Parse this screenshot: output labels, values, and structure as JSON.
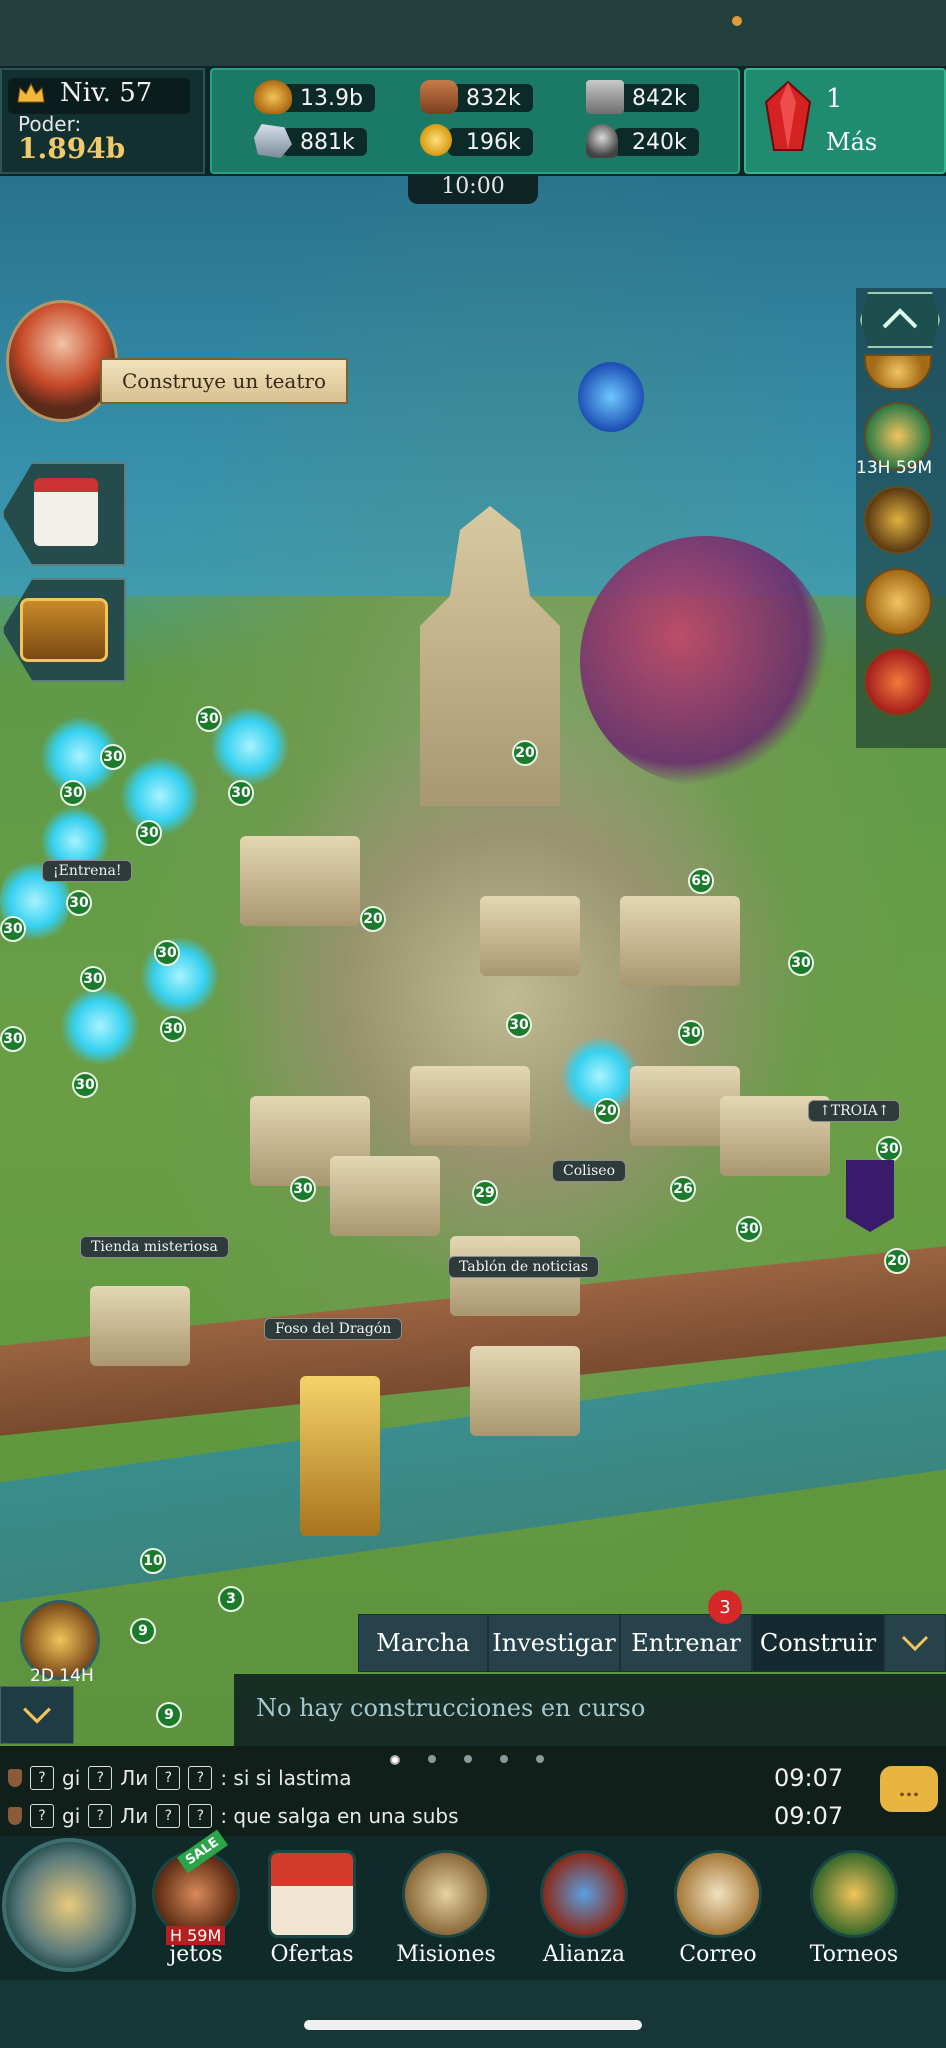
{
  "hud": {
    "level": "Niv. 57",
    "power_label": "Poder:",
    "power_value": "1.894b",
    "resources": [
      {
        "icon": "bread-icon",
        "value": "13.9b"
      },
      {
        "icon": "wood-logs-icon",
        "value": "832k"
      },
      {
        "icon": "stone-icon",
        "value": "842k"
      },
      {
        "icon": "iron-ore-icon",
        "value": "881k"
      },
      {
        "icon": "gold-coin-icon",
        "value": "196k"
      },
      {
        "icon": "helmet-icon",
        "value": "240k"
      }
    ],
    "gems": "1",
    "more_label": "Más",
    "timer": "10:00"
  },
  "map": {
    "quest_text": "Construye un teatro",
    "labels": {
      "train": "¡Entrena!",
      "troia": "↑TROIA↑",
      "coliseum": "Coliseo",
      "mystery_shop": "Tienda misteriosa",
      "notice_board": "Tablón de noticias",
      "dragon_pit": "Foso del Dragón"
    },
    "levels": [
      "30",
      "30",
      "30",
      "30",
      "30",
      "30",
      "30",
      "30",
      "30",
      "30",
      "30",
      "30",
      "20",
      "20",
      "20",
      "69",
      "30",
      "30",
      "30",
      "30",
      "29",
      "26",
      "30",
      "30",
      "20",
      "10",
      "3",
      "9",
      "9"
    ],
    "right_timer": "13H 59M",
    "gift_timer": "2D 14H"
  },
  "actions": {
    "tabs": [
      "Marcha",
      "Investigar",
      "Entrenar",
      "Construir"
    ],
    "badge": "3",
    "status": "No hay construcciones en curso"
  },
  "chat": {
    "messages": [
      {
        "user": "gi",
        "user2": "Ли",
        "text": ": si si lastima",
        "time": "09:07"
      },
      {
        "user": "gi",
        "user2": "Ли",
        "text": ": que salga en una subs",
        "time": "09:07"
      }
    ],
    "bubble": "..."
  },
  "nav": {
    "sale": "SALE",
    "sale_timer": "H 59M",
    "items": [
      "jetos",
      "Ofertas",
      "Misiones",
      "Alianza",
      "Correo",
      "Torneos"
    ]
  },
  "colors": {
    "accent_green": "#1b7a66",
    "gold_text": "#f0c96a",
    "badge_red": "#d62828",
    "level_badge": "#1c7a2c"
  }
}
